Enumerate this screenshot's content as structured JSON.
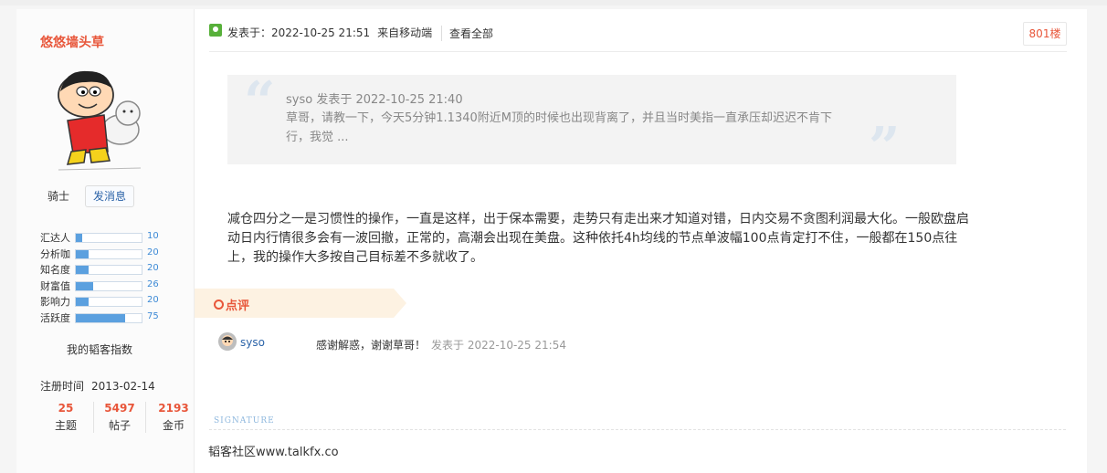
{
  "sidebar": {
    "username": "悠悠墙头草",
    "rank": "骑士",
    "message_button": "发消息",
    "stats": [
      {
        "label": "汇达人",
        "value": "10",
        "fraction": 0.1
      },
      {
        "label": "分析咖",
        "value": "20",
        "fraction": 0.2
      },
      {
        "label": "知名度",
        "value": "20",
        "fraction": 0.2
      },
      {
        "label": "财富值",
        "value": "26",
        "fraction": 0.26
      },
      {
        "label": "影响力",
        "value": "20",
        "fraction": 0.2
      },
      {
        "label": "活跃度",
        "value": "75",
        "fraction": 0.75
      }
    ],
    "rating_title": "我的韬客指数",
    "reg_label": "注册时间",
    "reg_date": "2013-02-14",
    "counts": [
      {
        "number": "25",
        "label": "主题"
      },
      {
        "number": "5497",
        "label": "帖子"
      },
      {
        "number": "2193",
        "label": "金币"
      }
    ]
  },
  "post": {
    "meta": "发表于：2022-10-25 21:51",
    "source": "来自移动端",
    "view_all": "查看全部",
    "floor": "801楼",
    "quote_head": "syso 发表于 2022-10-25 21:40",
    "quote_body": "草哥，请教一下，今天5分钟1.1340附近M顶的时候也出现背离了，并且当时美指一直承压却迟迟不肯下行，我觉 ...",
    "content": "减仓四分之一是习惯性的操作，一直是这样，出于保本需要，走势只有走出来才知道对错，日内交易不贪图利润最大化。一般欧盘启动日内行情很多会有一波回撤，正常的，高潮会出现在美盘。这种依托4h均线的节点单波幅100点肯定打不住，一般都在150点往上，我的操作大多按自己目标差不多就收了。"
  },
  "comments": {
    "tab_label": "点评",
    "items": [
      {
        "user": "syso",
        "text": "感谢解惑，谢谢草哥！",
        "time": "发表于 2022-10-25 21:54"
      }
    ]
  },
  "signature": {
    "label": "SIGNATURE",
    "text": "韬客社区www.talkfx.co"
  },
  "colors": {
    "accent": "#e8563a",
    "link": "#2b63a8",
    "bar": "#5ba0df",
    "quote_bg": "#f3f3f3",
    "tab_bg": "#fdf2e2"
  }
}
